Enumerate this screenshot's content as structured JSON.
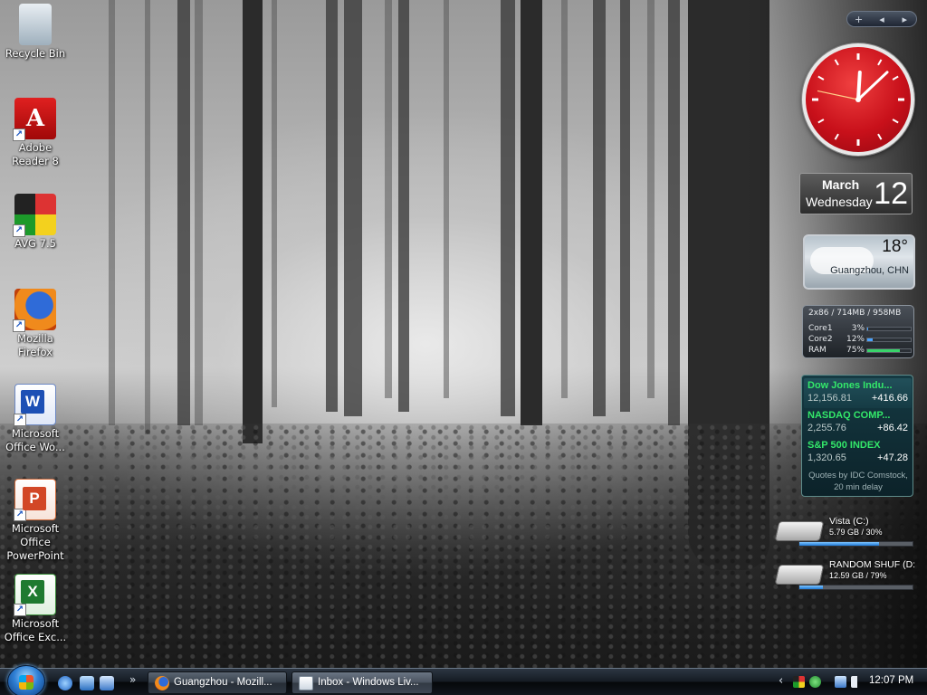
{
  "desktop": {
    "icons": [
      {
        "label": "Recycle Bin",
        "icon": "recycle-bin-icon"
      },
      {
        "label": "Adobe Reader 8",
        "icon": "adobe-reader-icon"
      },
      {
        "label": "AVG 7.5",
        "icon": "avg-icon"
      },
      {
        "label": "Mozilla Firefox",
        "icon": "firefox-icon"
      },
      {
        "label": "Microsoft Office Wo...",
        "icon": "word-icon"
      },
      {
        "label": "Microsoft Office PowerPoint",
        "icon": "powerpoint-icon"
      },
      {
        "label": "Microsoft Office Exc...",
        "icon": "excel-icon"
      }
    ]
  },
  "sidebar": {
    "controls": {
      "add": "+",
      "prev": "◂",
      "next": "▸"
    },
    "clock": {
      "hour": 12,
      "minute": 7,
      "second": 47
    },
    "calendar": {
      "month": "March",
      "weekday": "Wednesday",
      "day": "12"
    },
    "weather": {
      "temperature": "18°",
      "city": "Guangzhou, CHN"
    },
    "cpu": {
      "header": "2x86 / 714MB / 958MB",
      "rows": [
        {
          "label": "Core1",
          "value": "3%",
          "fraction": 0.03,
          "color": "#4aa3ff"
        },
        {
          "label": "Core2",
          "value": "12%",
          "fraction": 0.12,
          "color": "#4aa3ff"
        },
        {
          "label": "RAM",
          "value": "75%",
          "fraction": 0.75,
          "color": "#38d46a"
        }
      ]
    },
    "stocks": {
      "items": [
        {
          "name": "Dow Jones Indu...",
          "price": "12,156.81",
          "change": "+416.66"
        },
        {
          "name": "NASDAQ COMP...",
          "price": "2,255.76",
          "change": "+86.42"
        },
        {
          "name": "S&P 500 INDEX",
          "price": "1,320.65",
          "change": "+47.28"
        }
      ],
      "footer": "Quotes by IDC Comstock, 20 min delay"
    },
    "drives": [
      {
        "name": "Vista (C:)",
        "size": "5.79 GB / 30%",
        "fraction": 0.7
      },
      {
        "name": "RANDOM SHUF (D:",
        "size": "12.59 GB / 79%",
        "fraction": 0.21
      }
    ]
  },
  "taskbar": {
    "more": "»",
    "tasks": [
      {
        "label": "Guangzhou - Mozill...",
        "icon": "firefox-icon"
      },
      {
        "label": "Inbox - Windows Liv...",
        "icon": "mail-icon"
      }
    ],
    "tray": {
      "chevron": "‹",
      "time": "12:07 PM"
    }
  }
}
